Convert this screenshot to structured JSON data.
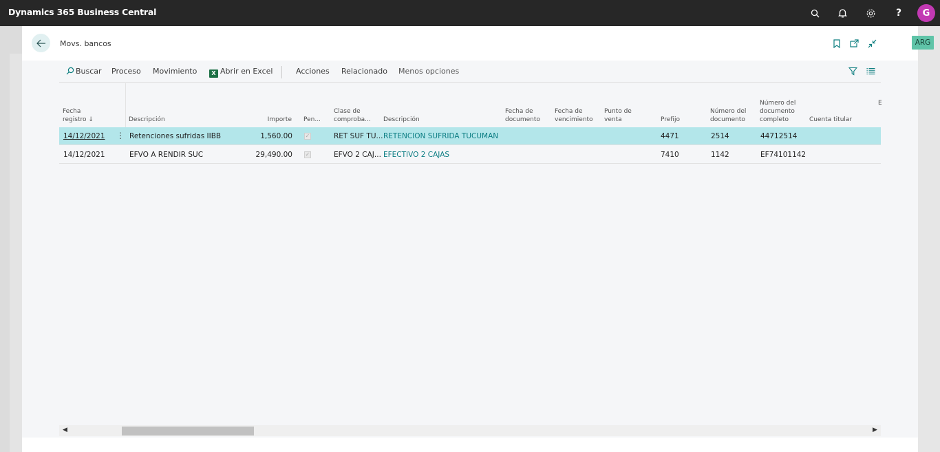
{
  "app": {
    "title": "Dynamics 365 Business Central",
    "avatar_initial": "G",
    "company_badge": "ARG",
    "icons": [
      "search-icon",
      "bell-icon",
      "gear-icon",
      "help-icon"
    ]
  },
  "page": {
    "title": "Movs. bancos"
  },
  "actions": {
    "search": "Buscar",
    "process": "Proceso",
    "movement": "Movimiento",
    "excel": "Abrir en Excel",
    "actions": "Acciones",
    "related": "Relacionado",
    "fewer": "Menos opciones"
  },
  "table": {
    "headers": {
      "posting_date": "Fecha registro",
      "description": "Descripción",
      "amount": "Importe",
      "pending": "Pen...",
      "doc_class": "Clase de comproba...",
      "description2": "Descripción",
      "doc_date": "Fecha de documento",
      "due_date": "Fecha de vencimiento",
      "point_of_sale": "Punto de venta",
      "prefix": "Prefijo",
      "doc_number": "Número del documento",
      "full_doc_number": "Número del documento completo",
      "holder_account": "Cuenta titular",
      "extra": "E"
    },
    "rows": [
      {
        "posting_date": "14/12/2021",
        "description": "Retenciones sufridas IIBB",
        "amount": "1,560.00",
        "doc_class": "RET SUF TU...",
        "description2": "RETENCION SUFRIDA TUCUMAN",
        "prefix": "4471",
        "doc_number": "2514",
        "full_doc_number": "44712514"
      },
      {
        "posting_date": "14/12/2021",
        "description": "EFVO A RENDIR SUC",
        "amount": "29,490.00",
        "doc_class": "EFVO 2 CAJ...",
        "description2": "EFECTIVO 2 CAJAS",
        "prefix": "7410",
        "doc_number": "1142",
        "full_doc_number": "EF74101142"
      }
    ]
  }
}
